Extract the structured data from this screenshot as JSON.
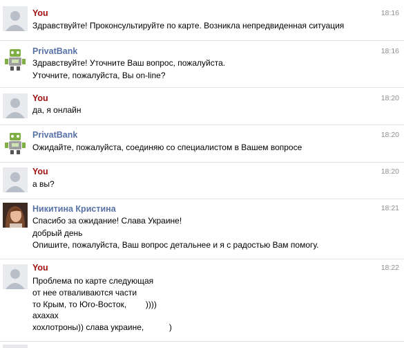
{
  "messages": [
    {
      "sender": "You",
      "time": "18:16",
      "lines": [
        "Здравствуйте! Проконсультируйте по карте. Возникла непредвиденная ситуация"
      ]
    },
    {
      "sender": "PrivatBank",
      "time": "18:16",
      "lines": [
        "Здравствуйте! Уточните Ваш вопрос, пожалуйста.",
        "Уточните, пожалуйста, Вы on-line?"
      ]
    },
    {
      "sender": "You",
      "time": "18:20",
      "lines": [
        "да, я онлайн"
      ]
    },
    {
      "sender": "PrivatBank",
      "time": "18:20",
      "lines": [
        "Ожидайте, пожалуйста, соединяю со специалистом в Вашем вопросе"
      ]
    },
    {
      "sender": "You",
      "time": "18:20",
      "lines": [
        "а вы?"
      ]
    },
    {
      "sender": "Никитина Кристина",
      "time": "18:21",
      "lines": [
        "Спасибо за ожидание! Слава Украине!",
        "добрый день",
        "Опишите, пожалуйста, Ваш вопрос детальнее и я с радостью Вам помогу."
      ]
    },
    {
      "sender": "You",
      "time": "18:22",
      "lines": [
        "Проблема по карте следующая",
        "от нее отваливаются части",
        "то Крым, то Юго-Восток,",
        "))))",
        "ахахах",
        "хохлотроны)) слава украине,",
        ")"
      ]
    }
  ],
  "colors": {
    "you_name": "#a01010",
    "bank_name": "#5872a8",
    "agent_name": "#5872a8",
    "time": "#8e8e8e",
    "separator": "#e3e3e3"
  },
  "icons": {
    "you_avatar": "default-user-silhouette-icon",
    "bank_avatar": "privatbank-robot-icon",
    "agent_avatar": "agent-photo",
    "smile": "smiley-emoticon-icon"
  }
}
